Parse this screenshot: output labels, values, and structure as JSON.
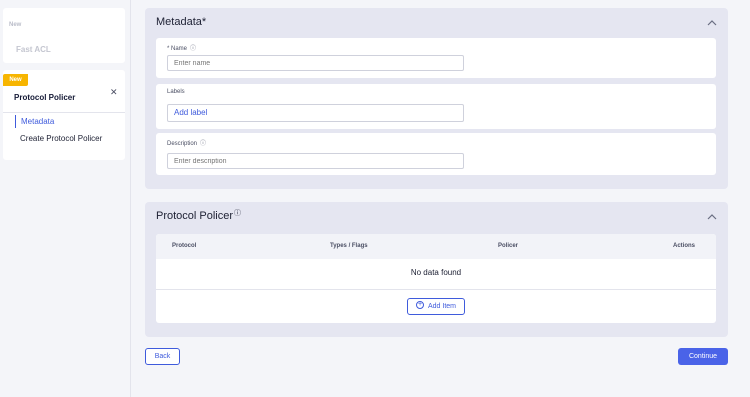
{
  "sidebar": {
    "items": [
      {
        "tag": "New",
        "title": "Fast ACL"
      },
      {
        "tag": "New",
        "title": "Protocol Policer",
        "close_icon": "close-icon",
        "steps": [
          {
            "label": "Metadata",
            "active": true
          },
          {
            "label": "Create Protocol Policer",
            "active": false
          }
        ]
      }
    ],
    "accent_color": "#f7b500"
  },
  "metadata": {
    "title": "Metadata*",
    "name": {
      "label": "* Name",
      "placeholder": "Enter name",
      "info_icon": "info-icon"
    },
    "labels": {
      "label": "Labels",
      "add_label": "Add label"
    },
    "description": {
      "label": "Description",
      "placeholder": "Enter description",
      "info_icon": "info-icon"
    }
  },
  "policer": {
    "title": "Protocol Policer",
    "columns": [
      "Protocol",
      "Types / Flags",
      "Policer",
      "Actions"
    ],
    "empty_text": "No data found",
    "add_item": "Add Item"
  },
  "footer": {
    "back": "Back",
    "continue": "Continue"
  },
  "colors": {
    "primary": "#4a63e8",
    "link": "#3f5bdc"
  }
}
